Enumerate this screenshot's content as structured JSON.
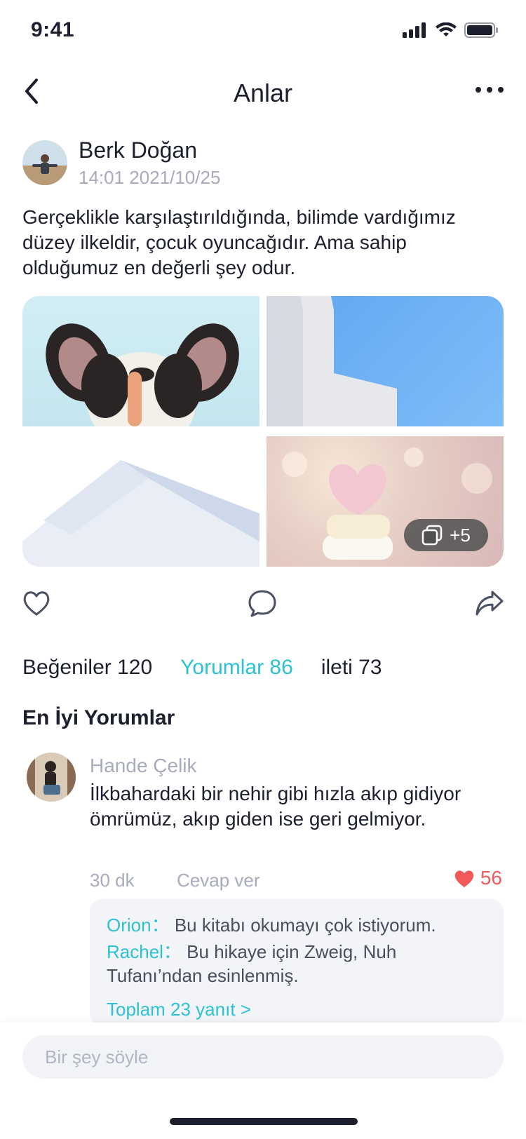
{
  "status_bar": {
    "time": "9:41"
  },
  "nav": {
    "title": "Anlar"
  },
  "post": {
    "author": "Berk Doğan",
    "timestamp": "14:01 2021/10/25",
    "text": "Gerçeklikle karşılaştırıldığında, bilimde vardığımız düzey ilkeldir, çocuk oyuncağıdır. Ama sahip olduğumuz en değerli şey odur.",
    "more_images": "+5"
  },
  "stats": {
    "likes": "Beğeniler 120",
    "comments": "Yorumlar 86",
    "shares": "ileti 73"
  },
  "section_title": "En İyi Yorumlar",
  "top_comment": {
    "name": "Hande Çelik",
    "text": "İlkbahardaki bir nehir gibi hızla akıp gidiyor ömrümüz, akıp giden ise geri gelmiyor.",
    "time": "30 dk",
    "reply_label": "Cevap ver",
    "likes": "56",
    "replies": [
      {
        "name": "Orion：",
        "text": "Bu kitabı okumayı çok istiyorum."
      },
      {
        "name": "Rachel：",
        "text": "Bu hikaye için Zweig, Nuh Tufanı’ndan esinlenmiş."
      }
    ],
    "total_replies": "Toplam 23 yanıt  >"
  },
  "input": {
    "placeholder": "Bir şey söyle"
  },
  "colors": {
    "accent": "#2cc2d3",
    "like_red": "#f25a5a",
    "muted": "#a7abbd"
  }
}
